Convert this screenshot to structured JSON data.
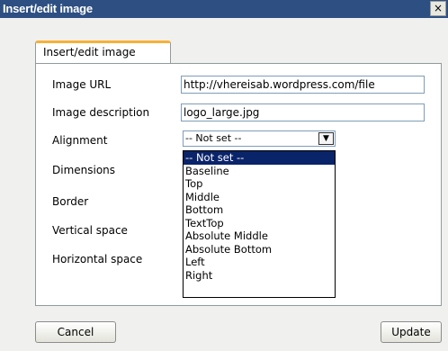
{
  "window": {
    "title": "Insert/edit image",
    "close_glyph": "×"
  },
  "tabs": [
    {
      "label": "Insert/edit image",
      "active": true
    }
  ],
  "fields": {
    "image_url": {
      "label": "Image URL",
      "value": "http://vhereisab.wordpress.com/file"
    },
    "image_description": {
      "label": "Image description",
      "value": "logo_large.jpg"
    },
    "alignment": {
      "label": "Alignment",
      "value": "-- Not set --"
    },
    "dimensions": {
      "label": "Dimensions"
    },
    "border": {
      "label": "Border"
    },
    "vertical_space": {
      "label": "Vertical space"
    },
    "horizontal_space": {
      "label": "Horizontal space"
    }
  },
  "alignment_options": [
    "-- Not set --",
    "Baseline",
    "Top",
    "Middle",
    "Bottom",
    "TextTop",
    "Absolute Middle",
    "Absolute Bottom",
    "Left",
    "Right"
  ],
  "buttons": {
    "cancel": "Cancel",
    "update": "Update"
  },
  "colors": {
    "titlebar": "#2d4f82",
    "tab_accent": "#f7b137",
    "selection": "#0a246a",
    "dialog_bg": "#f0f0ee"
  }
}
